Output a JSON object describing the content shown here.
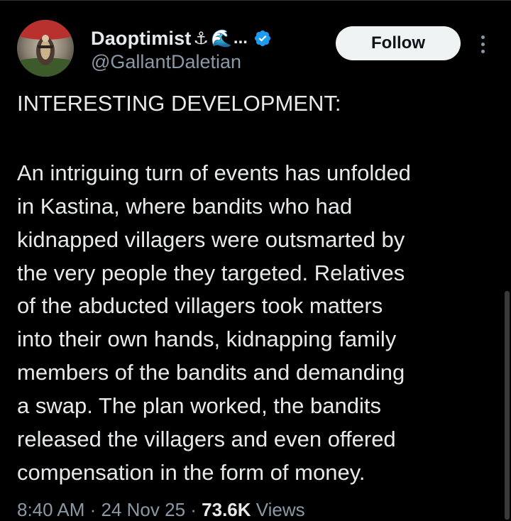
{
  "author": {
    "display_name": "Daoptimist",
    "name_emoji_1": "⚓",
    "name_emoji_2": "🌊",
    "name_truncation": "...",
    "handle": "@GallantDaletian",
    "verified": true,
    "verified_color": "#1d9bf0",
    "avatar_icon": "avatar-emblem-icon"
  },
  "actions": {
    "follow_label": "Follow",
    "more_icon": "more-vertical-icon"
  },
  "tweet": {
    "heading": "INTERESTING DEVELOPMENT:",
    "lines": [
      "An intriguing turn of events has unfolded",
      "in Kastina, where bandits who had",
      "kidnapped villagers were outsmarted by",
      "the very people they targeted. Relatives",
      "of the abducted villagers took matters",
      "into their own hands, kidnapping family",
      "members of the bandits and demanding",
      "a swap. The plan worked, the bandits",
      "released the villagers and even offered",
      "compensation in the form of money."
    ]
  },
  "meta": {
    "time": "8:40 AM",
    "separator": " · ",
    "date": "24 Nov 25",
    "views_count": "73.6K",
    "views_label": " Views"
  },
  "colors": {
    "background": "#000000",
    "text_primary": "#e7e9ea",
    "text_secondary": "#8b98a5",
    "follow_bg": "#eff3f4"
  }
}
